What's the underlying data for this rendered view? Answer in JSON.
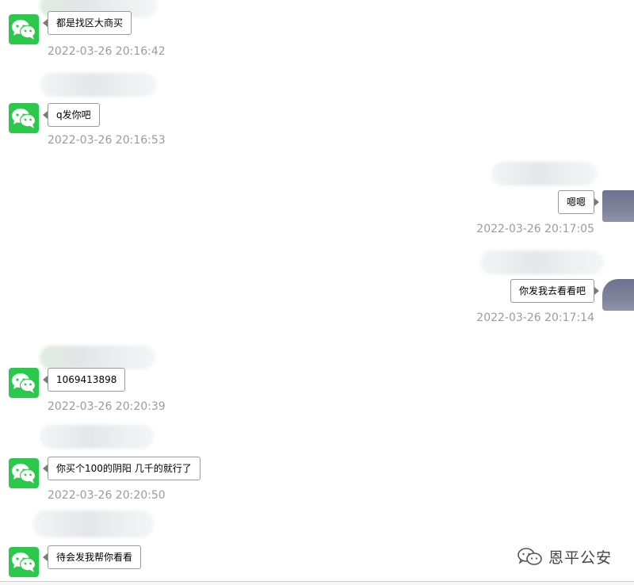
{
  "chat": {
    "messages": [
      {
        "side": "left",
        "text": "都是找区大商买",
        "time": "2022-03-26 20:16:42"
      },
      {
        "side": "left",
        "text": "q发你吧",
        "time": "2022-03-26 20:16:53"
      },
      {
        "side": "right",
        "text": "嗯嗯",
        "time": "2022-03-26 20:17:05"
      },
      {
        "side": "right",
        "text": "你发我去看看吧",
        "time": "2022-03-26 20:17:14"
      },
      {
        "side": "left",
        "text": "1069413898",
        "time": "2022-03-26 20:20:39"
      },
      {
        "side": "left",
        "text": "你买个100的阴阳 几千的就行了",
        "time": "2022-03-26 20:20:50"
      },
      {
        "side": "left",
        "text": "待会发我帮你看看",
        "time": ""
      }
    ]
  },
  "watermark": {
    "text": "恩平公安",
    "icon": "wechat-channel-icon"
  },
  "colors": {
    "wechat_green": "#2ac94b",
    "timestamp": "#9b9b9b",
    "bubble_border": "#9a9a9a"
  }
}
